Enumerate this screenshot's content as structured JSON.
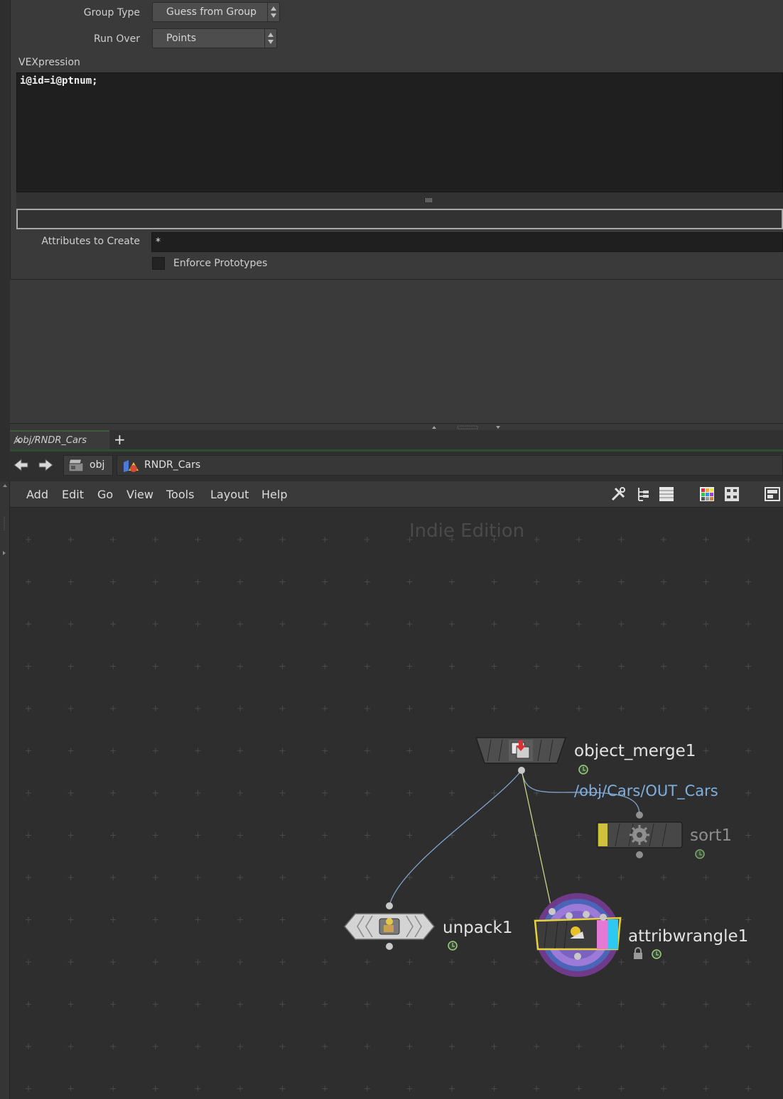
{
  "params": {
    "group_type_label": "Group Type",
    "group_type_value": "Guess from Group",
    "run_over_label": "Run Over",
    "run_over_value": "Points",
    "vexpression_label": "VEXpression",
    "vexpression_code": "i@id=i@ptnum;",
    "attributes_label": "Attributes to Create",
    "attributes_value": "*",
    "enforce_label": "Enforce Prototypes",
    "enforce_checked": false
  },
  "network": {
    "tab_label": "/obj/RNDR_Cars",
    "tab_close": "×",
    "tab_add": "+",
    "crumbs": [
      "obj",
      "RNDR_Cars"
    ],
    "menus": [
      "Add",
      "Edit",
      "Go",
      "View",
      "Tools",
      "Layout",
      "Help"
    ],
    "watermark": "Indie Edition",
    "nodes": {
      "object_merge": "object_merge1",
      "object_merge_path": "/obj/Cars/OUT_Cars",
      "sort": "sort1",
      "unpack": "unpack1",
      "wrangle": "attribwrangle1"
    },
    "colors": {
      "wire_blue": "#7fa3cc",
      "wire_yellow": "#c9d488",
      "path_link": "#7fb0e0",
      "sort_flag": "#e1d23b",
      "wrangle_pink": "#e27ad6",
      "wrangle_cyan": "#2fc8f0",
      "wrangle_ring": "#6f3a8a"
    },
    "icons": [
      "back-arrow-icon",
      "forward-arrow-icon",
      "obj-network-icon",
      "geo-node-icon",
      "wrench-icon",
      "tree-view-icon",
      "list-view-icon",
      "color-palette-icon",
      "shape-palette-icon",
      "pane-layout-icon",
      "lock-icon",
      "timer-icon"
    ]
  }
}
